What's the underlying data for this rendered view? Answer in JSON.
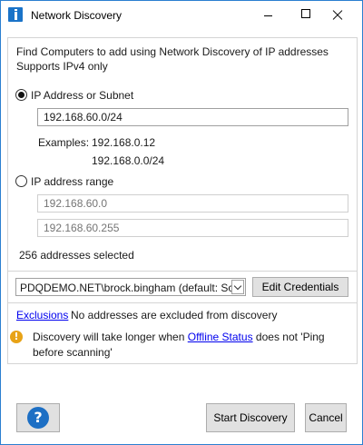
{
  "window": {
    "title": "Network Discovery"
  },
  "intro": {
    "line1": "Find Computers to add using Network Discovery of IP addresses",
    "line2": "Supports IPv4 only"
  },
  "ip_subnet": {
    "label": "IP Address or Subnet",
    "selected": true,
    "value": "192.168.60.0/24",
    "examples_label": "Examples:",
    "example1": "192.168.0.12",
    "example2": "192.168.0.0/24"
  },
  "ip_range": {
    "label": "IP address range",
    "selected": false,
    "start_placeholder": "192.168.60.0",
    "end_placeholder": "192.168.60.255"
  },
  "addresses_selected": "256 addresses selected",
  "credentials": {
    "selected": "PDQDEMO.NET\\brock.bingham (default: Sc",
    "edit_button": "Edit Credentials"
  },
  "exclusions": {
    "link": "Exclusions",
    "status": "No addresses are excluded from discovery"
  },
  "notice": {
    "text_before": "Discovery will take longer when",
    "link": "Offline Status",
    "text_after": "does not 'Ping",
    "line2": "before scanning'"
  },
  "footer": {
    "help_label": "?",
    "start_button": "Start Discovery",
    "cancel_button": "Cancel"
  },
  "icons": {
    "app": "network-discovery-app-icon",
    "info": "info-icon",
    "help": "help-icon"
  },
  "colors": {
    "accent": "#2b7fd0",
    "link": "#0000ee",
    "info": "#e8a317",
    "help": "#1d6fc4"
  }
}
